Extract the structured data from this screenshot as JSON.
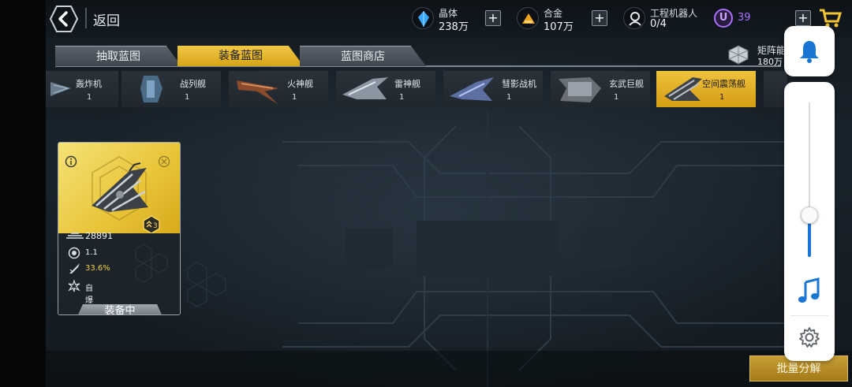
{
  "header": {
    "back_label": "返回"
  },
  "resources": [
    {
      "name": "晶体",
      "value": "238万",
      "icon": "crystal-icon",
      "color": "#3aa6ff"
    },
    {
      "name": "合金",
      "value": "107万",
      "icon": "alloy-icon",
      "color": "#f0a020"
    },
    {
      "name": "工程机器人",
      "value": "0/4",
      "icon": "robot-icon",
      "color": "#dfe5ea"
    }
  ],
  "currency": {
    "symbol": "U",
    "value": "39",
    "color": "#a970ff"
  },
  "tabs": [
    {
      "label": "抽取蓝图",
      "active": false
    },
    {
      "label": "装备蓝图",
      "active": true
    },
    {
      "label": "蓝图商店",
      "active": false
    }
  ],
  "matrix": {
    "name": "矩阵能",
    "value": "180万"
  },
  "ships": [
    {
      "name": "轰炸机",
      "count": "1",
      "active": false
    },
    {
      "name": "战列舰",
      "count": "1",
      "active": false
    },
    {
      "name": "火神舰",
      "count": "1",
      "active": false
    },
    {
      "name": "雷神舰",
      "count": "1",
      "active": false
    },
    {
      "name": "彗影战机",
      "count": "1",
      "active": false
    },
    {
      "name": "玄武巨舰",
      "count": "1",
      "active": false
    },
    {
      "name": "空间震荡舰",
      "count": "1",
      "active": true
    }
  ],
  "card": {
    "power": "28891",
    "rank": "3",
    "stats": [
      {
        "icon": "speed-icon",
        "value": "1.1",
        "highlight": false
      },
      {
        "icon": "rocket-icon",
        "value": "33.6%",
        "highlight": true
      },
      {
        "icon": "explosion-icon",
        "value": "自爆",
        "highlight": false
      }
    ],
    "equip_label": "装备中"
  },
  "batch_button_label": "批量分解",
  "overlay": {
    "volume_level": 0.27,
    "accent_color": "#1976d2"
  }
}
